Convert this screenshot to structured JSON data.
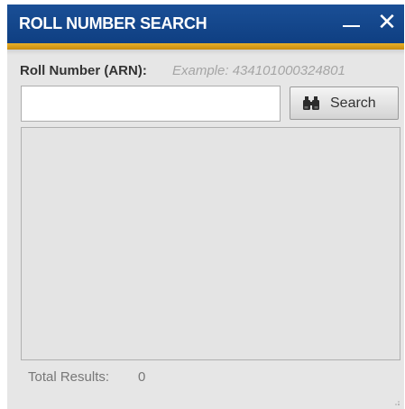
{
  "window": {
    "title": "ROLL NUMBER SEARCH",
    "minimize_icon": "minimize-icon",
    "close_glyph": "✕",
    "close_icon": "close-icon"
  },
  "search": {
    "label": "Roll Number (ARN):",
    "example": "Example: 434101000324801",
    "input_value": "",
    "button_label": "Search",
    "button_icon": "binoculars-icon"
  },
  "results": {
    "items": [],
    "total_label": "Total Results:",
    "total_value": "0"
  },
  "colors": {
    "titlebar": "#124690",
    "accent_bar": "#e0a21f",
    "panel_bg": "#e6e6e6"
  }
}
